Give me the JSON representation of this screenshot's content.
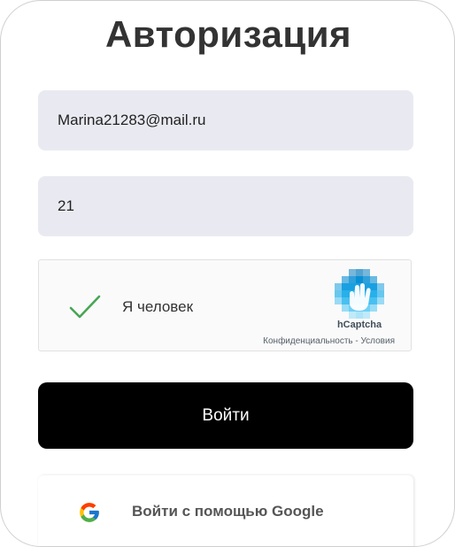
{
  "title": "Авторизация",
  "form": {
    "email_value": "Marina21283@mail.ru",
    "password_value": "21"
  },
  "captcha": {
    "label": "Я человек",
    "brand": "hCaptcha",
    "links": "Конфиденциальность - Условия",
    "check_color": "#47a654",
    "checked": true
  },
  "login_button": {
    "label": "Войти",
    "color": "#000000"
  },
  "google_button": {
    "label": "Войти с помощью Google",
    "icon": "google-icon"
  }
}
